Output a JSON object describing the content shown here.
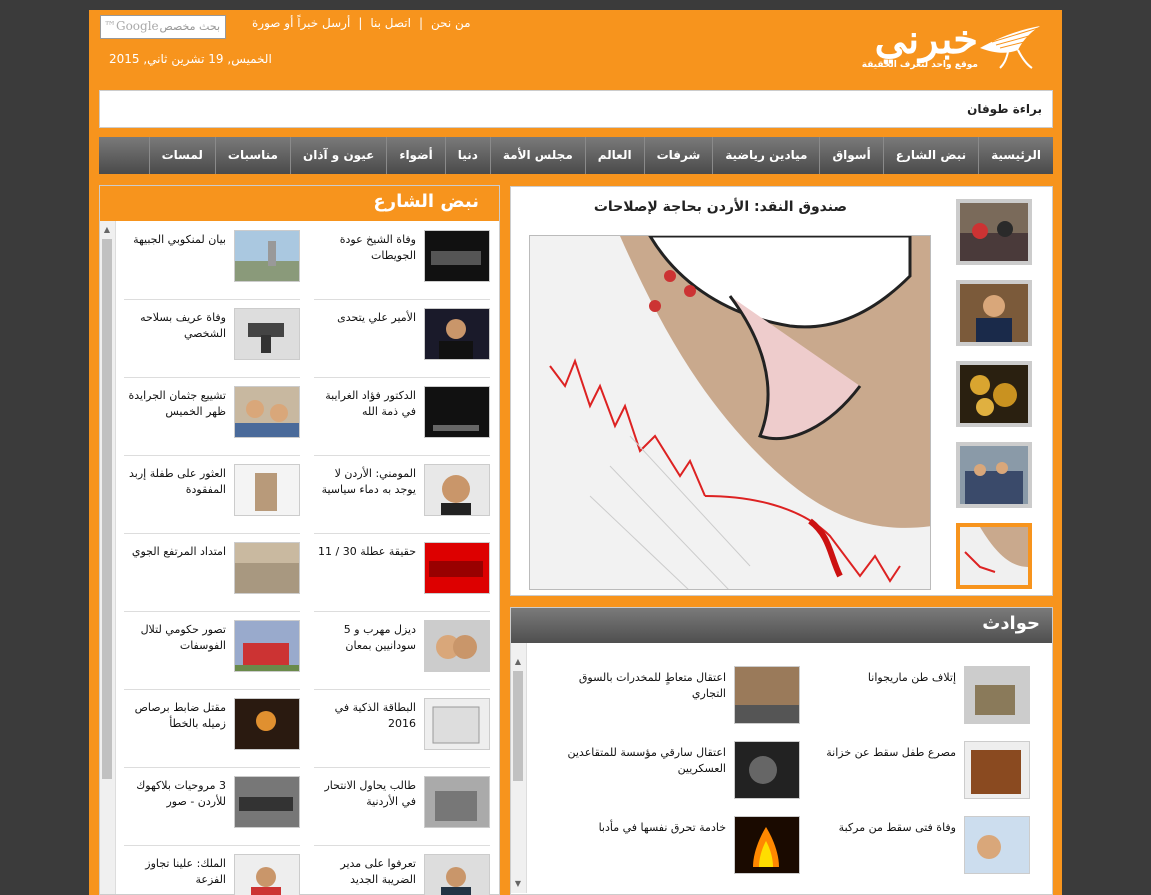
{
  "site": {
    "logo_text": "خبرني",
    "tagline": "موقع واحد لتعرف الحقيقة",
    "top_links": [
      "من نحن",
      "اتصل بنا",
      "أرسل خبراً أو صورة"
    ],
    "date": "الخميس, 19 تشرين ثاني, 2015",
    "search_placeholder": "بحث مخصص",
    "search_brand": "Google™"
  },
  "ticker": "براءة طوفان",
  "nav": [
    "الرئيسية",
    "نبض الشارع",
    "أسواق",
    "ميادين رياضية",
    "شرفات",
    "العالم",
    "مجلس الأمة",
    "دنيا",
    "أضواء",
    "عيون و آذان",
    "مناسبات",
    "لمسات"
  ],
  "featured": {
    "headline": "صندوق النقد: الأردن بحاجة لإصلاحات"
  },
  "street": {
    "title": "نبض الشارع",
    "items": [
      "وفاة الشيخ عودة الجويطات",
      "بيان لمنكوبي الجبيهة",
      "الأمير علي يتحدى",
      "وفاة عريف بسلاحه الشخصي",
      "الدكتور فؤاد الغرايبة في ذمة الله",
      "تشييع جثمان الجرايدة ظهر الخميس",
      "المومني: الأردن لا يوجد به دماء سياسية",
      "العثور على طفلة إربد المفقودة",
      "حقيقة عطلة 30 / 11",
      "امتداد المرتفع الجوي",
      "ديزل مهرب و 5 سودانيين بمعان",
      "تصور حكومي لتلال الفوسفات",
      "البطاقة الذكية في 2016",
      "مقتل ضابط برصاص زميله بالخطأ",
      "طالب يحاول الانتحار في الأردنية",
      "3 مروحيات بلاكهوك للأردن - صور",
      "تعرفوا على مدير الضريبة الجديد",
      "الملك: علينا تجاوز الفزعة"
    ]
  },
  "hawadith": {
    "title": "حوادث",
    "items": [
      "إتلاف طن ماريجوانا",
      "اعتقال متعاطٍ للمخدرات بالسوق التجاري",
      "مصرع طفل سقط عن خزانة",
      "اعتقال سارقي مؤسسة للمتقاعدين العسكريين",
      "وفاة فتى سقط من مركبة",
      "خادمة تحرق نفسها في مأدبا"
    ]
  },
  "colors": {
    "brand": "#f7941d",
    "nav": "#5a5a5a"
  }
}
